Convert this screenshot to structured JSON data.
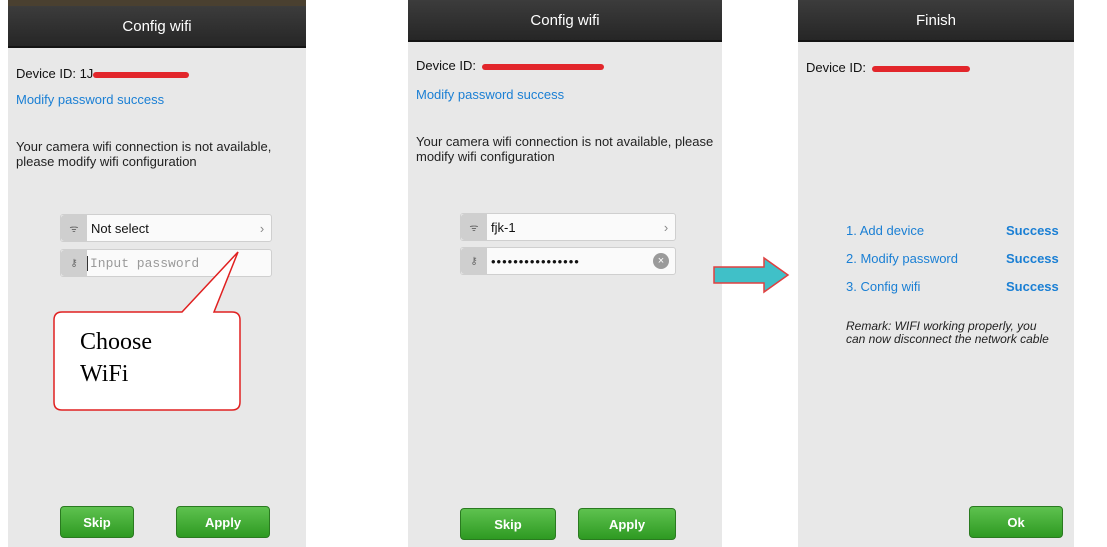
{
  "screens": [
    {
      "title": "Config wifi",
      "device_label": "Device ID: 1J",
      "link": "Modify password success",
      "message": "Your camera wifi connection is not available, please modify wifi configuration",
      "wifi_value": "Not select",
      "password_placeholder": "Input password",
      "skip": "Skip",
      "apply": "Apply"
    },
    {
      "title": "Config wifi",
      "device_label": "Device ID: ",
      "link": "Modify password success",
      "message": "Your camera wifi connection is not available, please modify wifi configuration",
      "wifi_value": "fjk-1",
      "password_value": "••••••••••••••••",
      "skip": "Skip",
      "apply": "Apply"
    },
    {
      "title": "Finish",
      "device_label": "Device ID: ",
      "steps": [
        {
          "label": "1. Add device",
          "status": "Success"
        },
        {
          "label": "2. Modify password",
          "status": "Success"
        },
        {
          "label": "3. Config wifi",
          "status": "Success"
        }
      ],
      "remark": "Remark: WIFI working properly, you can now disconnect the network cable",
      "ok": "Ok"
    }
  ],
  "callout": {
    "line1": "Choose",
    "line2": "WiFi"
  },
  "colors": {
    "redaction": "#e2262b",
    "link": "#1a7fd4",
    "button": "#3aa92e",
    "arrow": "#40c0c8",
    "arrow_border": "#e04040",
    "callout_border": "#e02020"
  }
}
